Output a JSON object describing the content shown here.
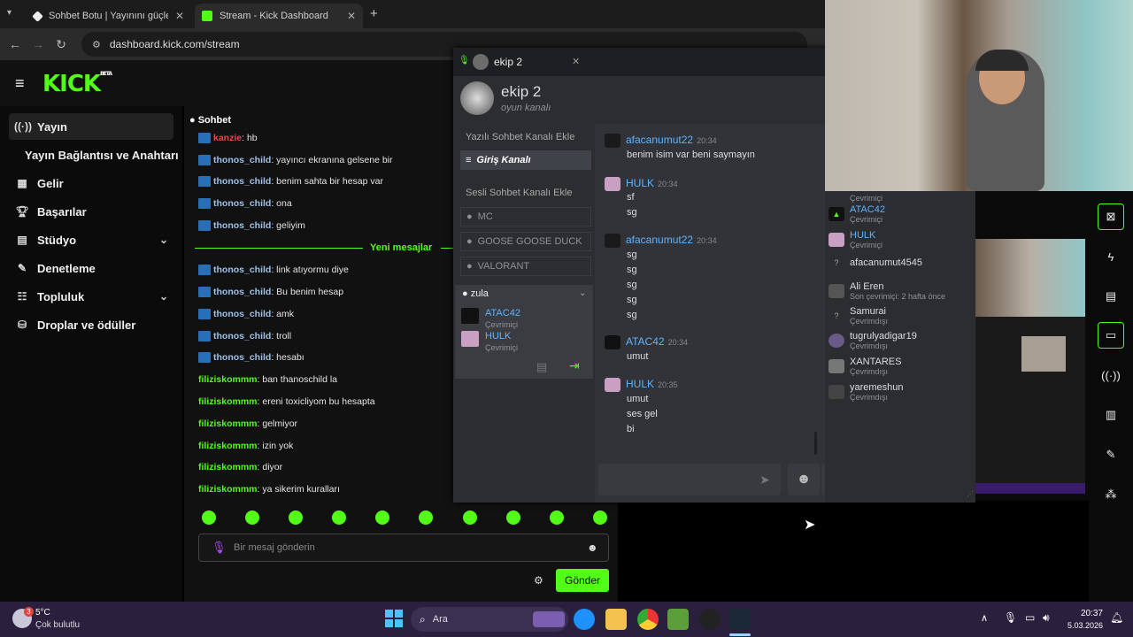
{
  "browser": {
    "tabs": [
      {
        "title": "Sohbet Botu | Yayınını güçlendi",
        "active": false
      },
      {
        "title": "Stream - Kick Dashboard",
        "active": true
      }
    ],
    "new_tab": "+",
    "url": "dashboard.kick.com/stream"
  },
  "kick": {
    "logo": "KICK",
    "beta": "BETA",
    "menu_icon": "hamburger-icon",
    "sidebar": [
      {
        "label": "Yayın",
        "icon": "broadcast-icon",
        "active": true
      },
      {
        "label": "Yayın Bağlantısı ve Anahtarı",
        "icon": ""
      },
      {
        "label": "Gelir",
        "icon": "chart-icon"
      },
      {
        "label": "Başarılar",
        "icon": "trophy-icon"
      },
      {
        "label": "Stüdyo",
        "icon": "studio-icon",
        "chevron": true
      },
      {
        "label": "Denetleme",
        "icon": "wrench-icon"
      },
      {
        "label": "Topluluk",
        "icon": "community-icon",
        "chevron": true
      },
      {
        "label": "Droplar ve ödüller",
        "icon": "drops-icon"
      }
    ],
    "chat": {
      "title": "Sohbet",
      "new_messages": "Yeni mesajlar",
      "messages_before": [
        {
          "user": "kanzie",
          "text": ": hb"
        },
        {
          "user": "thonos_child",
          "text": ": yayıncı ekranına gelsene bir"
        },
        {
          "user": "thonos_child",
          "text": ": benim sahta bir hesap var"
        },
        {
          "user": "thonos_child",
          "text": ": ona"
        },
        {
          "user": "thonos_child",
          "text": ": geliyim"
        }
      ],
      "messages_after": [
        {
          "user": "thonos_child",
          "text": ": link atıyormu diye"
        },
        {
          "user": "thonos_child",
          "text": ": Bu benim hesap"
        },
        {
          "user": "thonos_child",
          "text": ": amk"
        },
        {
          "user": "thonos_child",
          "text": ": troll"
        },
        {
          "user": "thonos_child",
          "text": ": hesabı"
        },
        {
          "user": "filiziskommm",
          "text": ": ban thanoschild la"
        },
        {
          "user": "filiziskommm",
          "text": ": ereni toxicliyom bu hesapta"
        },
        {
          "user": "filiziskommm",
          "text": ": gelmiyor"
        },
        {
          "user": "filiziskommm",
          "text": ": izin yok"
        },
        {
          "user": "filiziskommm",
          "text": ": diyor"
        },
        {
          "user": "filiziskommm",
          "text": ": ya sikerim kuralları"
        }
      ],
      "input_placeholder": "Bir mesaj gönderin",
      "send_label": "Gönder"
    }
  },
  "discord": {
    "tab_title": "ekip 2",
    "server_name": "ekip 2",
    "server_sub": "oyun kanalı",
    "add_text_channel": "Yazılı Sohbet Kanalı Ekle",
    "text_channel": "Giriş Kanalı",
    "add_voice_channel": "Sesli Sohbet Kanalı Ekle",
    "voice_channels": [
      "MC",
      "GOOSE GOOSE DUCK",
      "VALORANT"
    ],
    "active_voice": {
      "name": "zula",
      "users": [
        {
          "name": "ATAC42",
          "status": "Çevrimiçi"
        },
        {
          "name": "HULK",
          "status": "Çevrimiçi"
        }
      ]
    },
    "messages": [
      {
        "user": "afacanumut22",
        "time": "20:34",
        "lines": [
          "benim isim var beni saymayın"
        ]
      },
      {
        "user": "HULK",
        "time": "20:34",
        "lines": [
          "sf",
          "sg"
        ]
      },
      {
        "user": "afacanumut22",
        "time": "20:34",
        "lines": [
          "sg",
          "sg",
          "sg",
          "sg",
          "sg"
        ]
      },
      {
        "user": "ATAC42",
        "time": "20:34",
        "lines": [
          "umut"
        ]
      },
      {
        "user": "HULK",
        "time": "20:35",
        "lines": [
          "umut",
          "ses gel",
          "bi"
        ]
      }
    ],
    "members": [
      {
        "name": "",
        "status": "Çevrimiçi"
      },
      {
        "name": "ATAC42",
        "status": "Çevrimiçi"
      },
      {
        "name": "HULK",
        "status": "Çevrimiçi"
      },
      {
        "name": "afacanumut4545",
        "status": "Çevrimdışı"
      },
      {
        "name": "Ali Eren",
        "status": "Son çevrimiçi: 2 hafta önce"
      },
      {
        "name": "Samurai",
        "status": "Çevrimdışı"
      },
      {
        "name": "tugrulyadigar19",
        "status": "Çevrimdışı"
      },
      {
        "name": "XANTARES",
        "status": "Çevrimdışı"
      },
      {
        "name": "yaremeshun",
        "status": "Çevrimdışı"
      }
    ]
  },
  "taskbar": {
    "weather_temp": "5°C",
    "weather_desc": "Çok bulutlu",
    "weather_badge": "3",
    "search": "Ara",
    "time": "20:37",
    "date": "5.03.2026"
  },
  "colors": {
    "kick_green": "#53fc18",
    "discord_bg": "#313338",
    "taskbar": "#2a1f3d"
  }
}
